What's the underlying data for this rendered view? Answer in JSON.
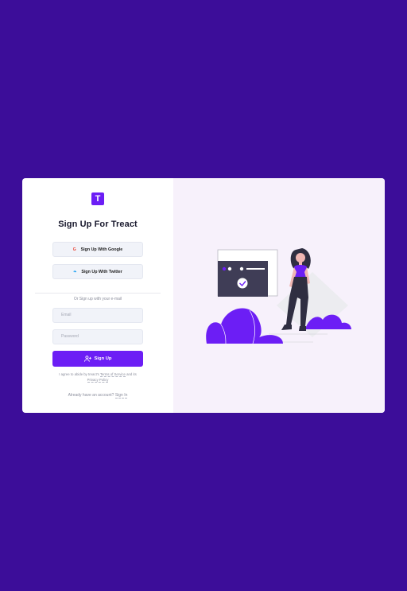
{
  "brand": {
    "logo_letter": "T",
    "accent": "#6c1ef5",
    "background": "#3c0d99"
  },
  "title": "Sign Up For Treact",
  "social": {
    "google_label": "Sign Up With Google",
    "google_icon_glyph": "G",
    "twitter_label": "Sign Up With Twitter",
    "twitter_icon_glyph": "❧"
  },
  "divider_text": "Or Sign up with your e-mail",
  "form": {
    "email_placeholder": "Email",
    "password_placeholder": "Password",
    "submit_label": "Sign Up"
  },
  "terms": {
    "prefix": "I agree to abide by treact's",
    "tos_link": "Terms of Service",
    "and": "and its",
    "privacy_link": "Privacy Policy"
  },
  "signin": {
    "prefix": "Already have an account?",
    "link": "Sign In"
  }
}
